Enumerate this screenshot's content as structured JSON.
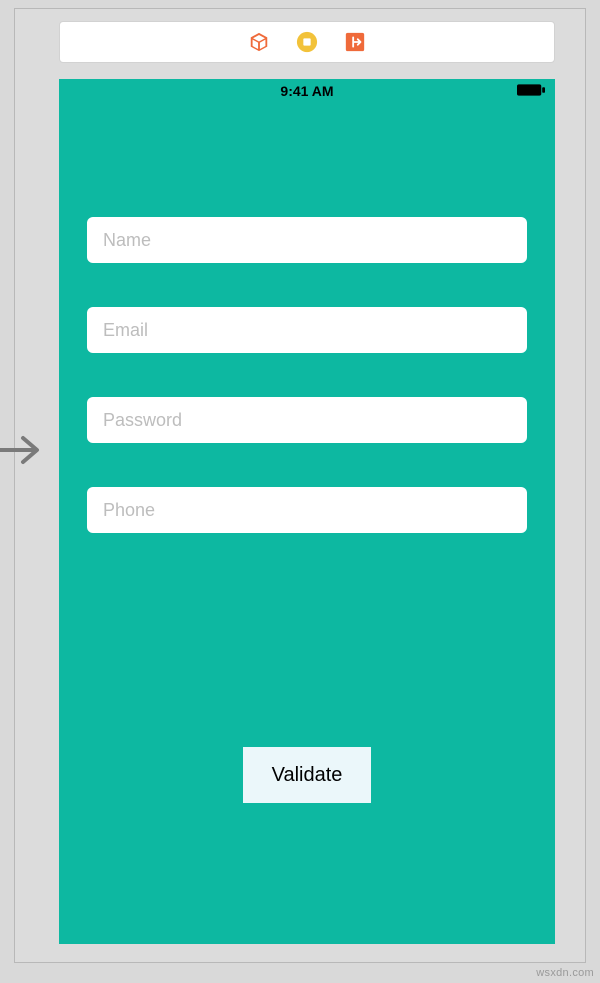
{
  "toolbar": {
    "icons": {
      "box": "box-3d-icon",
      "stop": "stop-circle-icon",
      "exit": "exit-square-icon"
    }
  },
  "status_bar": {
    "time": "9:41 AM"
  },
  "form": {
    "fields": [
      {
        "placeholder": "Name"
      },
      {
        "placeholder": "Email"
      },
      {
        "placeholder": "Password"
      },
      {
        "placeholder": "Phone"
      }
    ],
    "validate_label": "Validate"
  },
  "watermark": "wsxdn.com",
  "colors": {
    "accent": "#0db8a1",
    "toolbar_icon_orange": "#ef6a3a",
    "toolbar_icon_yellow": "#f2c23a",
    "button_bg": "#ebf7fa"
  }
}
